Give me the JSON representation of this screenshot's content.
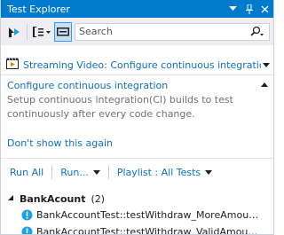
{
  "window": {
    "title": "Test Explorer",
    "dropdown_glyph": "▾",
    "pin_glyph": "⊥",
    "close_glyph": "×"
  },
  "toolbar": {
    "search_placeholder": "Search",
    "tools": [
      "run-failed-icon",
      "group-by-icon",
      "playlist-icon"
    ]
  },
  "banner": {
    "text": "Streaming Video: Configure continuous integratic"
  },
  "info": {
    "heading": "Configure continuous integration",
    "description_line1": "Setup continuous integration(CI) builds to test",
    "description_line2": "continuously after every code change."
  },
  "dismiss_link": "Don't show this again",
  "runbar": {
    "run_all": "Run All",
    "run": "Run...",
    "playlist": "Playlist : All Tests"
  },
  "tree": {
    "group_name": "BankAcount",
    "group_count": "(2)",
    "tests": [
      "BankAccountTest::testWithdraw_MoreAmount...",
      "BankAccountTest::testWithdraw_ValidAmount_..."
    ]
  },
  "colors": {
    "accent": "#007acc",
    "link": "#0e70c0",
    "toolbar_bg": "#eeeef2",
    "not_run_icon": "#1ba1e2"
  }
}
